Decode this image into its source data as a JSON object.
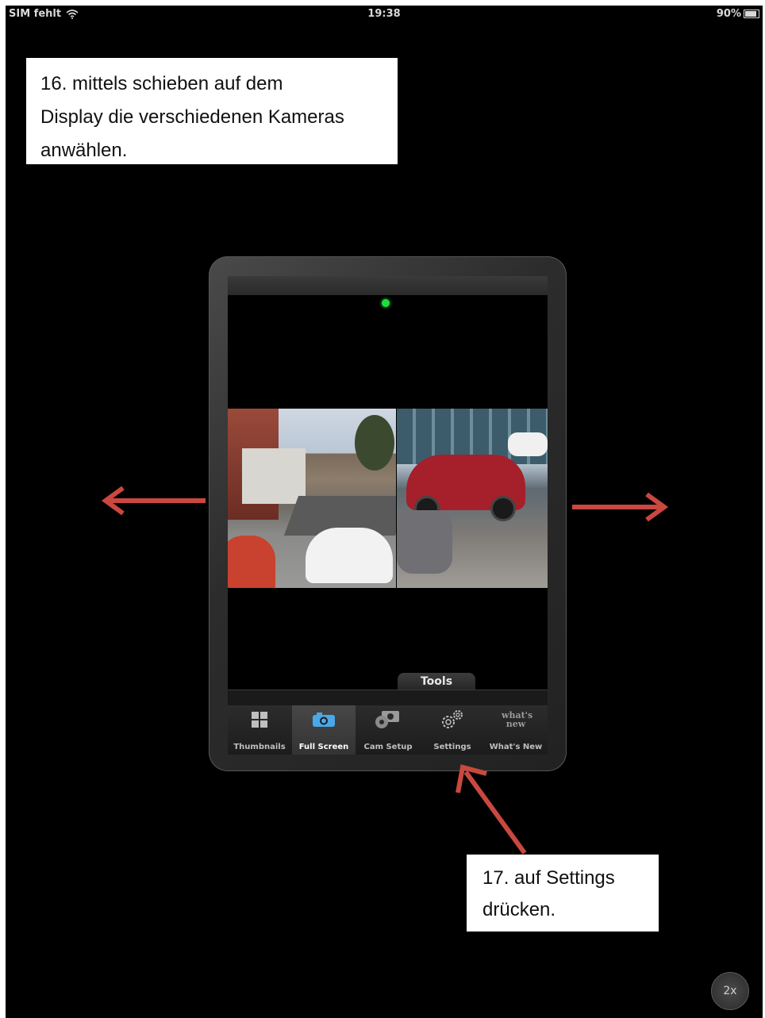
{
  "status_bar": {
    "carrier": "SIM fehlt",
    "wifi_icon": "wifi-icon",
    "time": "19:38",
    "battery_percent": "90%",
    "battery_level": 0.9
  },
  "callouts": {
    "step16": [
      "16. mittels schieben auf dem",
      "Display die verschiedenen Kameras",
      "anwählen."
    ],
    "step17": [
      "17. auf Settings",
      "drücken."
    ]
  },
  "device": {
    "status_color": "#1fdc3a",
    "tools_label": "Tools",
    "tabs": [
      {
        "label": "Thumbnails",
        "icon": "grid-icon",
        "active": false
      },
      {
        "label": "Full Screen",
        "icon": "camera-icon",
        "active": true
      },
      {
        "label": "Cam Setup",
        "icon": "camera-gear-icon",
        "active": false
      },
      {
        "label": "Settings",
        "icon": "gears-icon",
        "active": false
      },
      {
        "label": "What's New",
        "icon": "whats-new-icon",
        "icon_text": "what's new",
        "active": false
      }
    ]
  },
  "annotation_color": "#c9483f",
  "zoom_button": {
    "label": "2x"
  }
}
